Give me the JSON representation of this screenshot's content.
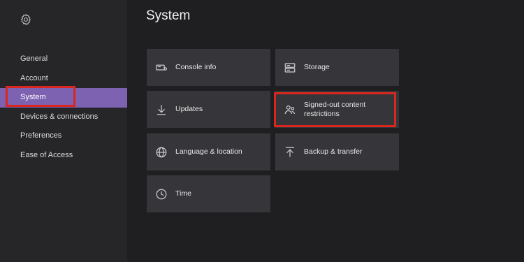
{
  "sidebar": {
    "settings_icon": "gear-icon",
    "items": [
      {
        "label": "General"
      },
      {
        "label": "Account"
      },
      {
        "label": "System",
        "active": true
      },
      {
        "label": "Devices & connections"
      },
      {
        "label": "Preferences"
      },
      {
        "label": "Ease of Access"
      }
    ]
  },
  "main": {
    "title": "System",
    "tiles": [
      {
        "label": "Console info",
        "icon": "console-icon"
      },
      {
        "label": "Storage",
        "icon": "storage-icon"
      },
      {
        "label": "Updates",
        "icon": "download-arrow-icon"
      },
      {
        "label": "Signed-out content restrictions",
        "icon": "people-icon"
      },
      {
        "label": "Language & location",
        "icon": "globe-icon"
      },
      {
        "label": "Backup & transfer",
        "icon": "upload-arrow-icon"
      },
      {
        "label": "Time",
        "icon": "clock-icon"
      }
    ]
  },
  "colors": {
    "accent": "#7e62b2",
    "highlight": "#d9271f",
    "tile": "#36363a",
    "sidebar": "#262628",
    "background": "#1f1f21"
  }
}
